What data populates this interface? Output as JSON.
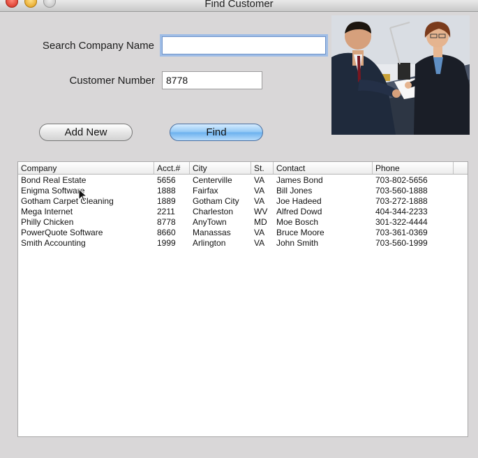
{
  "window": {
    "title": "Find Customer"
  },
  "search": {
    "company_label": "Search Company Name",
    "company_value": "",
    "number_label": "Customer Number",
    "number_value": "8778"
  },
  "buttons": {
    "add_new": "Add New",
    "find": "Find"
  },
  "table": {
    "columns": [
      "Company",
      "Acct.#",
      "City",
      "St.",
      "Contact",
      "Phone"
    ],
    "rows": [
      [
        "Bond Real Estate",
        "5656",
        "Centerville",
        "VA",
        "James Bond",
        "703-802-5656"
      ],
      [
        "Enigma Software",
        "1888",
        "Fairfax",
        "VA",
        "Bill Jones",
        "703-560-1888"
      ],
      [
        "Gotham Carpet Cleaning",
        "1889",
        "Gotham City",
        "VA",
        "Joe Hadeed",
        "703-272-1888"
      ],
      [
        "Mega Internet",
        "2211",
        "Charleston",
        "WV",
        "Alfred Dowd",
        "404-344-2233"
      ],
      [
        "Philly Chicken",
        "8778",
        "AnyTown",
        "MD",
        "Moe Bosch",
        "301-322-4444"
      ],
      [
        "PowerQuote Software",
        "8660",
        "Manassas",
        "VA",
        "Bruce Moore",
        "703-361-0369"
      ],
      [
        "Smith Accounting",
        "1999",
        "Arlington",
        "VA",
        "John Smith",
        "703-560-1999"
      ]
    ]
  },
  "colors": {
    "window_bg": "#d9d7d8",
    "focus_ring": "#9fbde6",
    "default_button": "#8fc6f4"
  }
}
